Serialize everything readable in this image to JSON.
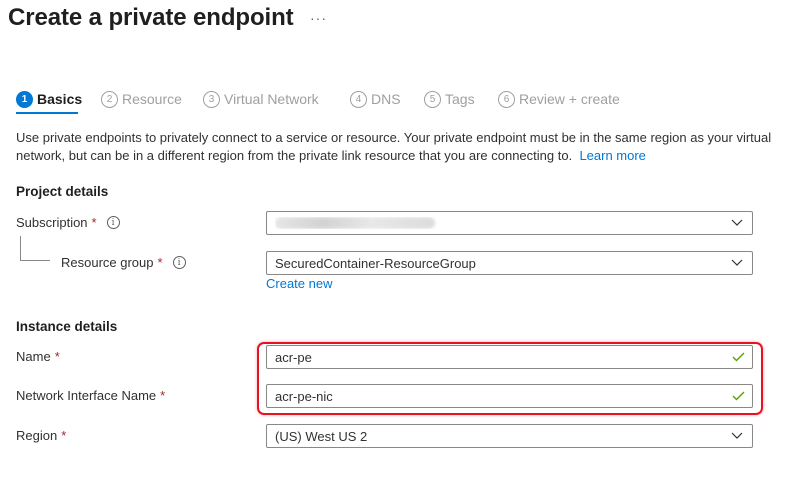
{
  "page": {
    "title": "Create a private endpoint",
    "more_label": "···"
  },
  "steps": [
    {
      "num": "1",
      "label": "Basics",
      "active": true
    },
    {
      "num": "2",
      "label": "Resource",
      "active": false
    },
    {
      "num": "3",
      "label": "Virtual Network",
      "active": false
    },
    {
      "num": "4",
      "label": "DNS",
      "active": false
    },
    {
      "num": "5",
      "label": "Tags",
      "active": false
    },
    {
      "num": "6",
      "label": "Review + create",
      "active": false
    }
  ],
  "intro": {
    "text": "Use private endpoints to privately connect to a service or resource. Your private endpoint must be in the same region as your virtual network, but can be in a different region from the private link resource that you are connecting to.",
    "link": "Learn more"
  },
  "project": {
    "heading": "Project details",
    "subscription_label": "Subscription",
    "subscription_value_redacted": true,
    "resource_group_label": "Resource group",
    "resource_group_value": "SecuredContainer-ResourceGroup",
    "create_new": "Create new"
  },
  "instance": {
    "heading": "Instance details",
    "name_label": "Name",
    "name_value": "acr-pe",
    "nic_label": "Network Interface Name",
    "nic_value": "acr-pe-nic",
    "region_label": "Region",
    "region_value": "(US) West US 2"
  },
  "common": {
    "required_mark": "*",
    "info_glyph": "i"
  },
  "icons": {
    "dropdown": "chevron-down-icon",
    "valid": "checkmark-icon",
    "info": "info-icon"
  },
  "colors": {
    "accent": "#0078d4",
    "required": "#a4262c",
    "valid": "#57a300",
    "highlight": "#e81123"
  }
}
